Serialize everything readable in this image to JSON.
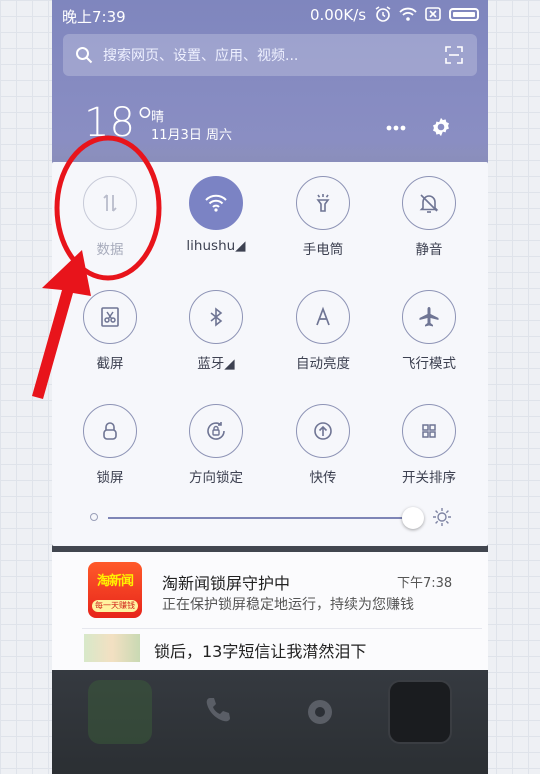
{
  "status_bar": {
    "time": "晚上7:39",
    "speed": "0.00K/s"
  },
  "search": {
    "placeholder": "搜索网页、设置、应用、视频..."
  },
  "weather": {
    "temp": "18°",
    "condition": "晴",
    "date": "11月3日 周六"
  },
  "toggles": [
    {
      "label": "数据",
      "icon": "data-transfer-icon",
      "active": false
    },
    {
      "label": "lihushu◢",
      "icon": "wifi-icon",
      "active": true
    },
    {
      "label": "手电筒",
      "icon": "flashlight-icon",
      "active": false
    },
    {
      "label": "静音",
      "icon": "silent-bell-icon",
      "active": false
    },
    {
      "label": "截屏",
      "icon": "screenshot-scissors-icon",
      "active": false
    },
    {
      "label": "蓝牙◢",
      "icon": "bluetooth-icon",
      "active": false
    },
    {
      "label": "自动亮度",
      "icon": "auto-brightness-icon",
      "active": false
    },
    {
      "label": "飞行模式",
      "icon": "airplane-icon",
      "active": false
    },
    {
      "label": "锁屏",
      "icon": "lock-icon",
      "active": false
    },
    {
      "label": "方向锁定",
      "icon": "rotation-lock-icon",
      "active": false
    },
    {
      "label": "快传",
      "icon": "quick-transfer-icon",
      "active": false
    },
    {
      "label": "开关排序",
      "icon": "grid-sort-icon",
      "active": false
    }
  ],
  "brightness": {
    "level": 1.0
  },
  "notifications": [
    {
      "title": "淘新闻锁屏守护中",
      "time": "下午7:38",
      "body": "正在保护锁屏稳定地运行，持续为您赚钱",
      "icon_top": "淘新闻",
      "icon_bottom": "每一天赚钱"
    },
    {
      "title": "锁后，13字短信让我潸然泪下"
    }
  ],
  "colors": {
    "accent": "#7b83c4",
    "annotation": "#e8141b"
  }
}
